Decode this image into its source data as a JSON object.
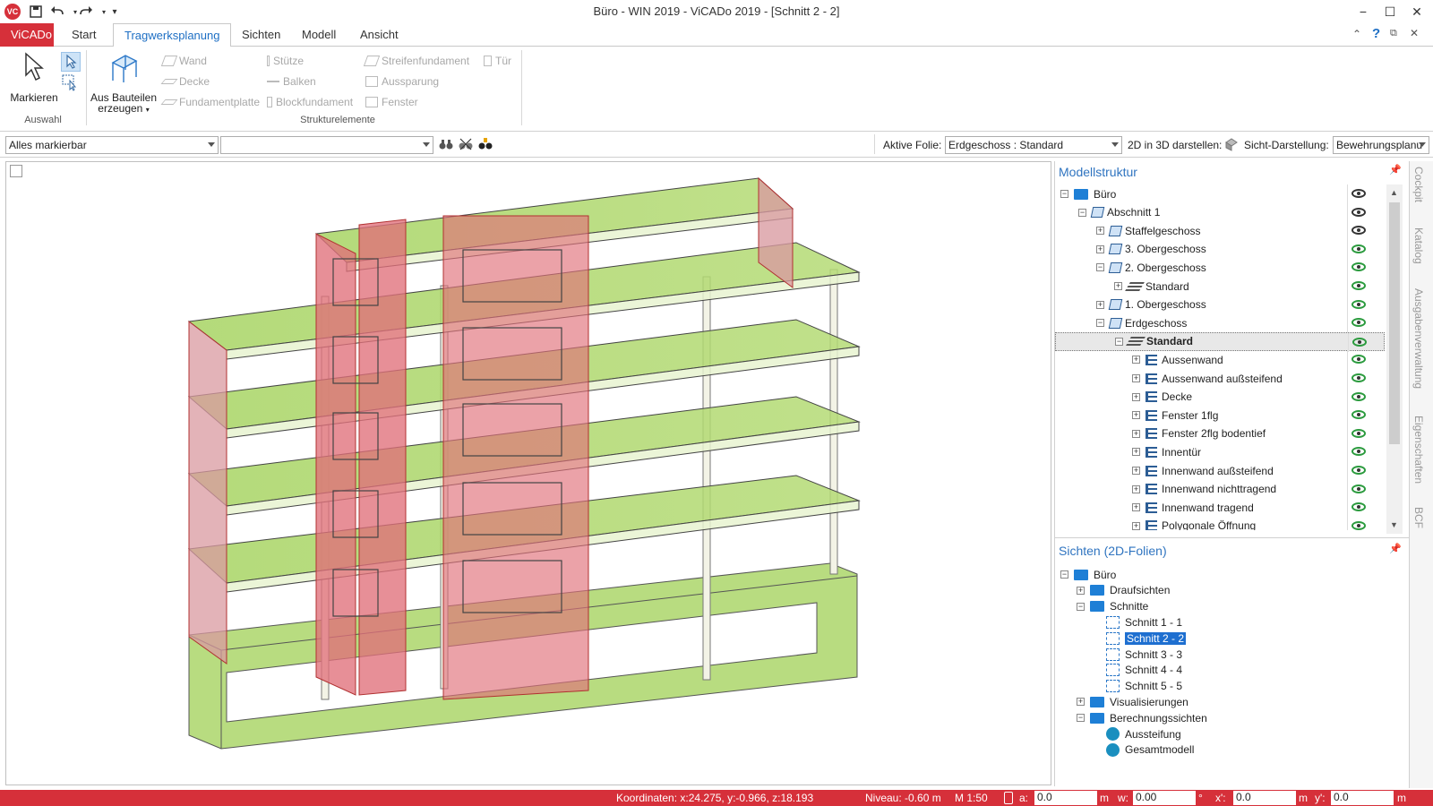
{
  "window": {
    "title": "Büro - WIN 2019 - ViCADo 2019 - [Schnitt 2 - 2]"
  },
  "ribbon": {
    "tabs": [
      "ViCADo",
      "Start",
      "Tragwerksplanung",
      "Sichten",
      "Modell",
      "Ansicht"
    ],
    "active_tab": "Tragwerksplanung",
    "markieren": "Markieren",
    "auswahl_label": "Auswahl",
    "aus_bauteilen_line1": "Aus Bauteilen",
    "aus_bauteilen_line2": "erzeugen",
    "elements_col1": [
      "Wand",
      "Decke",
      "Fundamentplatte"
    ],
    "elements_col2": [
      "Stütze",
      "Balken",
      "Blockfundament"
    ],
    "elements_col3": [
      "Streifenfundament",
      "Aussparung",
      "Fenster"
    ],
    "elements_col4": [
      "Tür"
    ],
    "strukturelemente_label": "Strukturelemente"
  },
  "toolbar": {
    "filter_value": "Alles markierbar",
    "second_combo_value": "",
    "aktive_folie_label": "Aktive Folie:",
    "aktive_folie_value": "Erdgeschoss : Standard",
    "darstellen_label": "2D in 3D darstellen:",
    "sicht_label": "Sicht-Darstellung:",
    "sicht_value": "Bewehrungsplanu"
  },
  "model_structure": {
    "title": "Modellstruktur",
    "items": [
      {
        "label": "Büro",
        "level": 0,
        "exp": "−",
        "icon": "folder-icon"
      },
      {
        "label": "Abschnitt 1",
        "level": 1,
        "exp": "−",
        "icon": "section-block-icon"
      },
      {
        "label": "Staffelgeschoss",
        "level": 2,
        "exp": "+",
        "icon": "floor-icon"
      },
      {
        "label": "3. Obergeschoss",
        "level": 2,
        "exp": "+",
        "icon": "floor-icon"
      },
      {
        "label": "2. Obergeschoss",
        "level": 2,
        "exp": "−",
        "icon": "floor-icon"
      },
      {
        "label": "Standard",
        "level": 3,
        "exp": "+",
        "icon": "layer-icon"
      },
      {
        "label": "1. Obergeschoss",
        "level": 2,
        "exp": "+",
        "icon": "floor-icon"
      },
      {
        "label": "Erdgeschoss",
        "level": 2,
        "exp": "−",
        "icon": "floor-icon"
      },
      {
        "label": "Standard",
        "level": 3,
        "exp": "−",
        "icon": "layer-icon",
        "bold": true,
        "selected": true
      },
      {
        "label": "Aussenwand",
        "level": 4,
        "exp": "+",
        "icon": "list-icon"
      },
      {
        "label": "Aussenwand außsteifend",
        "level": 4,
        "exp": "+",
        "icon": "list-icon"
      },
      {
        "label": "Decke",
        "level": 4,
        "exp": "+",
        "icon": "list-icon"
      },
      {
        "label": "Fenster 1flg",
        "level": 4,
        "exp": "+",
        "icon": "list-icon"
      },
      {
        "label": "Fenster 2flg bodentief",
        "level": 4,
        "exp": "+",
        "icon": "list-icon"
      },
      {
        "label": "Innentür",
        "level": 4,
        "exp": "+",
        "icon": "list-icon"
      },
      {
        "label": "Innenwand außsteifend",
        "level": 4,
        "exp": "+",
        "icon": "list-icon"
      },
      {
        "label": "Innenwand nichttragend",
        "level": 4,
        "exp": "+",
        "icon": "list-icon"
      },
      {
        "label": "Innenwand tragend",
        "level": 4,
        "exp": "+",
        "icon": "list-icon"
      },
      {
        "label": "Polygonale Öffnung",
        "level": 4,
        "exp": "+",
        "icon": "list-icon"
      }
    ]
  },
  "views": {
    "title": "Sichten (2D-Folien)",
    "items": [
      {
        "label": "Büro",
        "level": 0,
        "exp": "−",
        "icon": "folder-icon"
      },
      {
        "label": "Draufsichten",
        "level": 1,
        "exp": "+",
        "icon": "folder-icon"
      },
      {
        "label": "Schnitte",
        "level": 1,
        "exp": "−",
        "icon": "folder-icon"
      },
      {
        "label": "Schnitt 1 - 1",
        "level": 2,
        "icon": "section-icon"
      },
      {
        "label": "Schnitt 2 - 2",
        "level": 2,
        "icon": "section-icon",
        "selected": true
      },
      {
        "label": "Schnitt 3 - 3",
        "level": 2,
        "icon": "section-icon"
      },
      {
        "label": "Schnitt 4 - 4",
        "level": 2,
        "icon": "section-icon"
      },
      {
        "label": "Schnitt 5 - 5",
        "level": 2,
        "icon": "section-icon"
      },
      {
        "label": "Visualisierungen",
        "level": 1,
        "exp": "+",
        "icon": "folder-icon"
      },
      {
        "label": "Berechnungssichten",
        "level": 1,
        "exp": "−",
        "icon": "folder-icon"
      },
      {
        "label": "Aussteifung",
        "level": 2,
        "icon": "calc-icon"
      },
      {
        "label": "Gesamtmodell",
        "level": 2,
        "icon": "calc-icon"
      }
    ]
  },
  "side_tabs": [
    "Cockpit",
    "Katalog",
    "Ausgabenverwaltung",
    "Eigenschaften",
    "BCF"
  ],
  "statusbar": {
    "koordinaten": "Koordinaten: x:24.275, y:-0.966, z:18.193",
    "niveau": "Niveau: -0.60 m",
    "massstab": "M 1:50",
    "a_label": "a:",
    "a_value": "0.0",
    "a_unit": "m",
    "w_label": "w:",
    "w_value": "0.00",
    "w_unit": "°",
    "x_label": "x':",
    "x_value": "0.0",
    "x_unit": "m",
    "y_label": "y':",
    "y_value": "0.0",
    "y_unit": "m"
  },
  "colors": {
    "accent_red": "#d6303a",
    "accent_blue": "#2f74c0",
    "slab_green": "#9fcf56",
    "wall_red": "#e0707a"
  }
}
